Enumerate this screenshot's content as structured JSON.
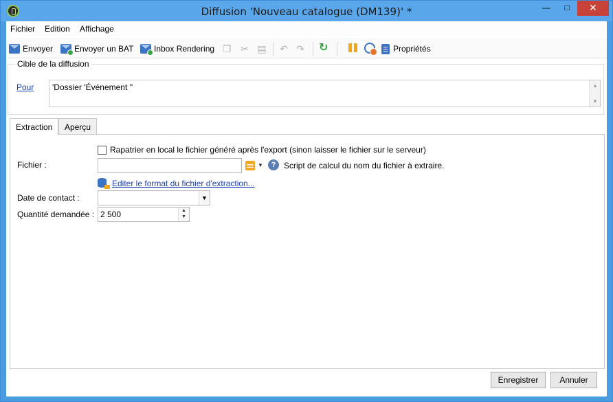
{
  "window": {
    "title": "Diffusion 'Nouveau catalogue (DM139)' *",
    "minimize": "—",
    "maximize": "□",
    "close": "✕",
    "app_icon": "adobe-campaign-icon"
  },
  "menu": {
    "items": [
      "Fichier",
      "Edition",
      "Affichage"
    ]
  },
  "toolbar": {
    "send_label": "Envoyer",
    "send_proof_label": "Envoyer un BAT",
    "inbox_label": "Inbox Rendering",
    "properties_label": "Propriétés",
    "icons": [
      "copy-icon",
      "cut-icon",
      "paste-icon",
      "undo-icon",
      "redo-icon",
      "refresh-icon",
      "gift-icon",
      "gauge-icon",
      "clipboard-icon"
    ]
  },
  "target": {
    "group_title": "Cible de la diffusion",
    "to_link": "Pour",
    "value": "'Dossier 'Événement ''"
  },
  "tabs": [
    "Extraction",
    "Aperçu"
  ],
  "extraction": {
    "checkbox_label": "Rapatrier en local le fichier généré après l'export (sinon laisser le fichier sur le serveur)",
    "checkbox_checked": false,
    "file_label": "Fichier :",
    "file_value": "",
    "help_text": "Script de calcul du nom du fichier à extraire.",
    "edit_format_link": "Editer le format du fichier d'extraction...",
    "contact_date_label": "Date de contact :",
    "contact_date_value": "",
    "quantity_label": "Quantité demandée :",
    "quantity_value": "2 500"
  },
  "footer": {
    "save_label": "Enregistrer",
    "cancel_label": "Annuler"
  },
  "colors": {
    "titlebar": "#59a7ea",
    "link": "#1a3fb4",
    "close_button": "#c8423a"
  }
}
